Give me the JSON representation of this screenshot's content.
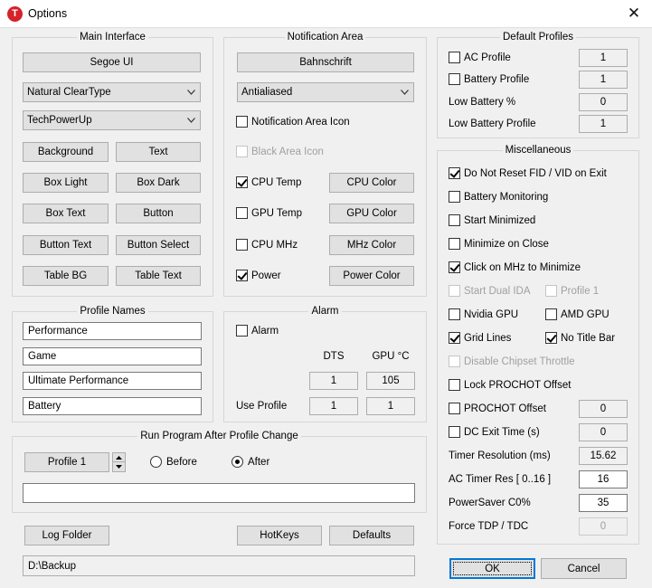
{
  "window": {
    "title": "Options",
    "icon_letter": "T",
    "close_glyph": "✕"
  },
  "main_interface": {
    "title": "Main Interface",
    "font_button": "Segoe UI",
    "font_smoothing": "Natural ClearType",
    "theme": "TechPowerUp",
    "buttons": [
      "Background",
      "Text",
      "Box Light",
      "Box Dark",
      "Box Text",
      "Button",
      "Button Text",
      "Button Select",
      "Table BG",
      "Table Text"
    ]
  },
  "notification_area": {
    "title": "Notification Area",
    "font_button": "Bahnschrift",
    "render_mode": "Antialiased",
    "notification_area_icon": "Notification Area Icon",
    "black_area_icon": "Black Area Icon",
    "cpu_temp": "CPU Temp",
    "cpu_color": "CPU Color",
    "gpu_temp": "GPU Temp",
    "gpu_color": "GPU Color",
    "cpu_mhz": "CPU MHz",
    "mhz_color": "MHz Color",
    "power": "Power",
    "power_color": "Power Color"
  },
  "default_profiles": {
    "title": "Default Profiles",
    "ac_profile": "AC Profile",
    "ac_profile_value": "1",
    "battery_profile": "Battery Profile",
    "battery_profile_value": "1",
    "low_battery_pct": "Low Battery %",
    "low_battery_pct_value": "0",
    "low_battery_profile": "Low Battery Profile",
    "low_battery_profile_value": "1"
  },
  "misc": {
    "title": "Miscellaneous",
    "do_not_reset": "Do Not Reset FID / VID on Exit",
    "battery_monitoring": "Battery Monitoring",
    "start_minimized": "Start Minimized",
    "minimize_on_close": "Minimize on Close",
    "click_mhz": "Click on MHz to Minimize",
    "start_dual_ida": "Start Dual IDA",
    "profile_1": "Profile 1",
    "nvidia_gpu": "Nvidia GPU",
    "amd_gpu": "AMD GPU",
    "grid_lines": "Grid Lines",
    "no_title_bar": "No Title Bar",
    "disable_chipset_throttle": "Disable Chipset Throttle",
    "lock_prochot": "Lock PROCHOT Offset",
    "prochot_offset": "PROCHOT Offset",
    "prochot_offset_value": "0",
    "dc_exit_time": "DC Exit Time (s)",
    "dc_exit_time_value": "0",
    "timer_resolution": "Timer Resolution (ms)",
    "timer_resolution_value": "15.62",
    "ac_timer_res": "AC Timer Res [ 0..16 ]",
    "ac_timer_res_value": "16",
    "powersaver": "PowerSaver C0%",
    "powersaver_value": "35",
    "force_tdp": "Force TDP / TDC",
    "force_tdp_value": "0"
  },
  "profile_names": {
    "title": "Profile Names",
    "names": [
      "Performance",
      "Game",
      "Ultimate Performance",
      "Battery"
    ]
  },
  "alarm": {
    "title": "Alarm",
    "alarm_label": "Alarm",
    "dts_header": "DTS",
    "gpu_header": "GPU °C",
    "dts_value": "1",
    "gpu_value": "105",
    "use_profile": "Use Profile",
    "use_profile_dts": "1",
    "use_profile_gpu": "1"
  },
  "run_program": {
    "title": "Run Program After Profile Change",
    "profile_button": "Profile 1",
    "before": "Before",
    "after": "After",
    "command": ""
  },
  "footer": {
    "log_folder": "Log Folder",
    "hotkeys": "HotKeys",
    "defaults": "Defaults",
    "path": "D:\\Backup",
    "ok": "OK",
    "cancel": "Cancel"
  }
}
